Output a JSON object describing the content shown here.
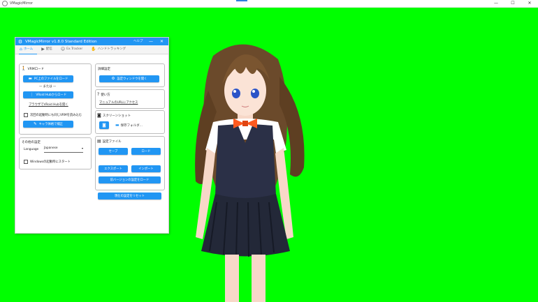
{
  "window": {
    "title": "VMagicMirror",
    "controls": {
      "minimize": "—",
      "maximize": "☐",
      "close": "✕"
    }
  },
  "panel": {
    "title": "VMagicMirror v1.8.0 Standard Edition",
    "help": "ヘルプ",
    "minimize": "—",
    "close": "✕",
    "tabs": [
      {
        "label": "ホーム"
      },
      {
        "label": "配信"
      },
      {
        "label": "Ex.Tracker"
      },
      {
        "label": "ハンドトラッキング"
      }
    ]
  },
  "vrm": {
    "title": "VRMロード",
    "load_pc": "PC上のファイルをロード",
    "or": "— または —",
    "load_hub": "VRoid Hubからロード",
    "open_hub": "ブラウザでVRoid Hubを開く",
    "auto_load_label": "次回の起動時にも同じVRMを読み込む",
    "calibrate": "キャラ体格で補正"
  },
  "other": {
    "title": "その他の設定",
    "language_label": "Language",
    "language_value": "Japanese",
    "startup_label": "Windowsの起動時にスタート"
  },
  "detail": {
    "title": "詳細設定",
    "open_settings": "設定ウィンドウを開く"
  },
  "usage": {
    "title": "使い方",
    "manual_link": "マニュアルのURLにアクセス"
  },
  "screenshot": {
    "title": "スクリーンショット",
    "folder": "保存フォルダ..."
  },
  "settings_file": {
    "title": "設定ファイル",
    "save": "セーブ",
    "load": "ロード",
    "export": "エクスポート",
    "import": "インポート",
    "load_previous": "前バージョンの設定をロード"
  },
  "reset": "現在の設定をリセット",
  "colors": {
    "background": "#00ff00",
    "accent": "#2196f3"
  }
}
